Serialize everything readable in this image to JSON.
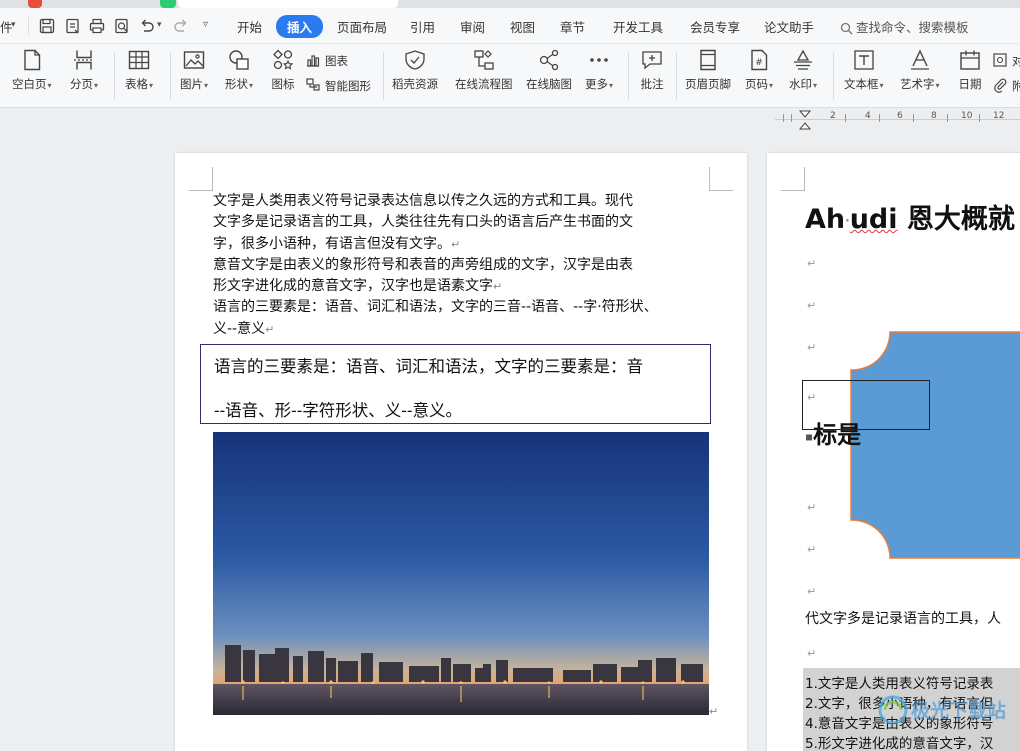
{
  "menubar": {
    "left_partial": "件",
    "tabs": [
      {
        "label": "开始",
        "active": false
      },
      {
        "label": "插入",
        "active": true
      },
      {
        "label": "页面布局",
        "active": false
      },
      {
        "label": "引用",
        "active": false
      },
      {
        "label": "审阅",
        "active": false
      },
      {
        "label": "视图",
        "active": false
      },
      {
        "label": "章节",
        "active": false
      },
      {
        "label": "开发工具",
        "active": false
      },
      {
        "label": "会员专享",
        "active": false
      },
      {
        "label": "论文助手",
        "active": false
      }
    ],
    "search_label": "查找命令、搜索模板",
    "accent_color": "#2b7bf0"
  },
  "ribbon": {
    "buttons": [
      {
        "label": "空白页",
        "icon": "blank-page-icon",
        "caret": true
      },
      {
        "label": "分页",
        "icon": "page-break-icon",
        "caret": true
      },
      {
        "label": "表格",
        "icon": "table-icon",
        "caret": true
      },
      {
        "label": "图片",
        "icon": "picture-icon",
        "caret": true
      },
      {
        "label": "形状",
        "icon": "shape-icon",
        "caret": true
      },
      {
        "label": "图标",
        "icon": "icon-library-icon",
        "caret": false
      },
      {
        "label": "稻壳资源",
        "icon": "docer-resource-icon",
        "caret": false
      },
      {
        "label": "在线流程图",
        "icon": "flowchart-icon",
        "caret": false
      },
      {
        "label": "在线脑图",
        "icon": "mindmap-icon",
        "caret": false
      },
      {
        "label": "更多",
        "icon": "more-icon",
        "caret": true
      },
      {
        "label": "批注",
        "icon": "comment-icon",
        "caret": false
      },
      {
        "label": "页眉页脚",
        "icon": "header-footer-icon",
        "caret": false
      },
      {
        "label": "页码",
        "icon": "page-number-icon",
        "caret": true
      },
      {
        "label": "水印",
        "icon": "watermark-icon",
        "caret": true
      },
      {
        "label": "文本框",
        "icon": "textbox-icon",
        "caret": true
      },
      {
        "label": "艺术字",
        "icon": "wordart-icon",
        "caret": true
      },
      {
        "label": "日期",
        "icon": "date-icon",
        "caret": false
      }
    ],
    "small": [
      {
        "label": "图表",
        "icon": "chart-icon"
      },
      {
        "label": "智能图形",
        "icon": "smart-graphic-icon"
      },
      {
        "label": "对",
        "icon": "object-icon"
      },
      {
        "label": "附",
        "icon": "attachment-icon"
      }
    ]
  },
  "ruler": {
    "numbers": [
      "2",
      "4",
      "6",
      "8",
      "10",
      "12"
    ]
  },
  "page1": {
    "paragraphs": [
      "文字是人类用表义符号记录表达信息以传之久远的方式和工具。现代文字多是记录语言的工具，人类往往先有口头的语言后产生书面的文字，很多小语种，有语言但没有文字。",
      "意音文字是由表义的象形符号和表音的声旁组成的文字，汉字是由表形文字进化成的意音文字，汉字也是语素文字",
      "语言的三要素是：语音、词汇和语法，文字的三音--语音、--字·符形状、义--意义"
    ],
    "para_lines": [
      [
        "文字是人类用表义符号记录表达信息以传之久远的方式和工具。现代",
        "文字多是记录语言的工具，人类往往先有口头的语言后产生书面的文",
        "字，很多小语种，有语言但没有文字。"
      ],
      [
        "意音文字是由表义的象形符号和表音的声旁组成的文字，汉字是由表",
        "形文字进化成的意音文字，汉字也是语素文字"
      ],
      [
        "语言的三要素是：语音、词汇和语法，文字的三音--语音、--字·符形状、",
        "义--意义"
      ]
    ],
    "textbox_lines": [
      "语言的三要素是：语音、词汇和语法，文字的三要素是：音",
      "--语音、形--字符形状、义--意义。"
    ]
  },
  "page2": {
    "heading_latin_a": "Ah",
    "heading_latin_b": "udi",
    "heading_cjk": "恩大概就",
    "heading2": "标是",
    "body_line": "代文字多是记录语言的工具，人",
    "list_items": [
      "1.文字是人类用表义符号记录表",
      "2.文字，很多小语种，有语言但",
      "4.意音文字是由表义的象形符号",
      "5.形文字进化成的意音文字，汉"
    ],
    "shape_color": "#5b9bd5",
    "shape_border": "#ed7d31"
  },
  "watermark": {
    "text": "极光下载站"
  }
}
